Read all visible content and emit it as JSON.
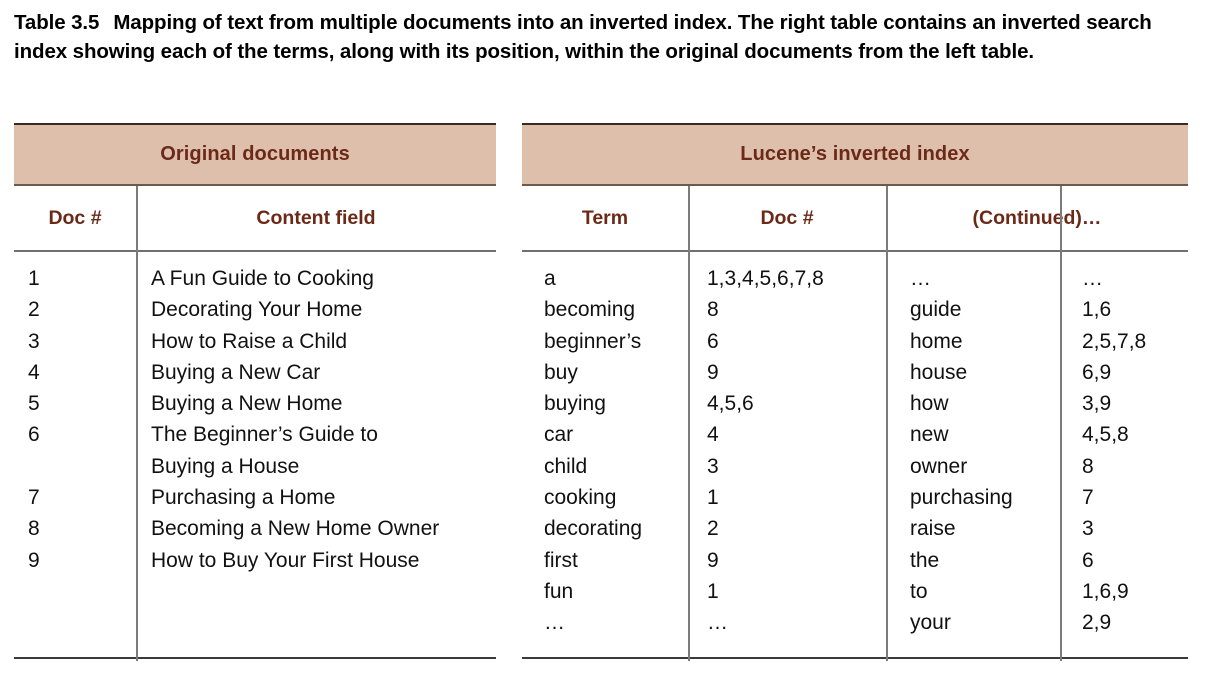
{
  "caption": {
    "label": "Table 3.5",
    "text": "Mapping of text from multiple documents into an inverted index. The right table contains an inverted search index showing each of the terms, along with its position, within the original documents from the left table."
  },
  "colors": {
    "band_background": "#debfac",
    "band_text": "#6b2a18",
    "body_text": "#111111",
    "rule": "#707070"
  },
  "left_table": {
    "band_title": "Original documents",
    "columns": [
      "Doc #",
      "Content field"
    ],
    "rows": [
      {
        "doc": "1",
        "content": "A Fun Guide to Cooking"
      },
      {
        "doc": "2",
        "content": "Decorating Your Home"
      },
      {
        "doc": "3",
        "content": "How to Raise a Child"
      },
      {
        "doc": "4",
        "content": "Buying a New Car"
      },
      {
        "doc": "5",
        "content": "Buying a New Home"
      },
      {
        "doc": "6",
        "content": "The Beginner’s Guide to"
      },
      {
        "doc": "",
        "content": "Buying a House"
      },
      {
        "doc": "7",
        "content": "Purchasing a Home"
      },
      {
        "doc": "8",
        "content": "Becoming a New Home Owner"
      },
      {
        "doc": "9",
        "content": "How to Buy Your First House"
      }
    ]
  },
  "right_table": {
    "band_title": "Lucene’s inverted index",
    "columns": [
      "Term",
      "Doc #",
      "(Continued)…"
    ],
    "rows": [
      {
        "term": "a",
        "docs": "1,3,4,5,6,7,8",
        "term2": "…",
        "docs2": "…"
      },
      {
        "term": "becoming",
        "docs": "8",
        "term2": "guide",
        "docs2": "1,6"
      },
      {
        "term": "beginner’s",
        "docs": "6",
        "term2": "home",
        "docs2": "2,5,7,8"
      },
      {
        "term": "buy",
        "docs": "9",
        "term2": "house",
        "docs2": "6,9"
      },
      {
        "term": "buying",
        "docs": "4,5,6",
        "term2": "how",
        "docs2": "3,9"
      },
      {
        "term": "car",
        "docs": "4",
        "term2": "new",
        "docs2": "4,5,8"
      },
      {
        "term": "child",
        "docs": "3",
        "term2": "owner",
        "docs2": "8"
      },
      {
        "term": "cooking",
        "docs": "1",
        "term2": "purchasing",
        "docs2": "7"
      },
      {
        "term": "decorating",
        "docs": "2",
        "term2": "raise",
        "docs2": "3"
      },
      {
        "term": "first",
        "docs": "9",
        "term2": "the",
        "docs2": "6"
      },
      {
        "term": "fun",
        "docs": "1",
        "term2": "to",
        "docs2": "1,6,9"
      },
      {
        "term": "…",
        "docs": "…",
        "term2": "your",
        "docs2": "2,9"
      }
    ]
  }
}
